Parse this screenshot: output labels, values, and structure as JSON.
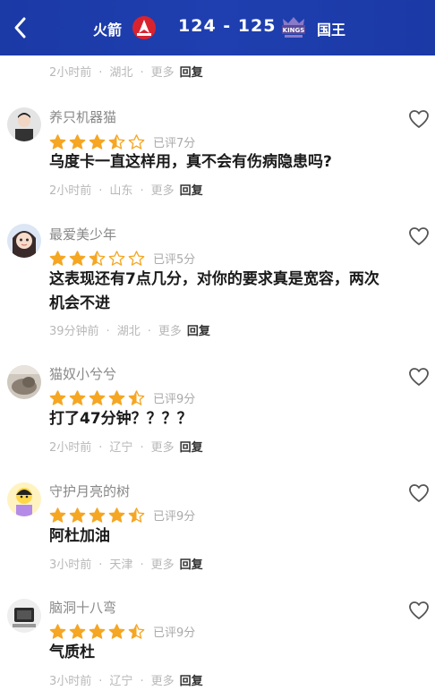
{
  "header": {
    "team_left": "火箭",
    "score": "124 - 125",
    "team_right": "国王",
    "logo_right_text": "KINGS"
  },
  "first_meta": {
    "time": "2小时前",
    "location": "湖北",
    "more": "更多",
    "reply": "回复"
  },
  "comments": [
    {
      "username": "养只机器猫",
      "rating": 3.5,
      "rated": "已评7分",
      "text": "乌度卡一直这样用，真不会有伤病隐患吗?",
      "time": "2小时前",
      "location": "山东",
      "more": "更多",
      "reply": "回复"
    },
    {
      "username": "最爱美少年",
      "rating": 2.5,
      "rated": "已评5分",
      "text": "这表现还有7点几分，对你的要求真是宽容，两次机会不进",
      "time": "39分钟前",
      "location": "湖北",
      "more": "更多",
      "reply": "回复"
    },
    {
      "username": "猫奴小兮兮",
      "rating": 4.5,
      "rated": "已评9分",
      "text": "打了47分钟？？？？",
      "time": "2小时前",
      "location": "辽宁",
      "more": "更多",
      "reply": "回复"
    },
    {
      "username": "守护月亮的树",
      "rating": 4.5,
      "rated": "已评9分",
      "text": "阿杜加油",
      "time": "3小时前",
      "location": "天津",
      "more": "更多",
      "reply": "回复"
    },
    {
      "username": "脑洞十八弯",
      "rating": 4.5,
      "rated": "已评9分",
      "text": "气质杜",
      "time": "3小时前",
      "location": "辽宁",
      "more": "更多",
      "reply": "回复"
    }
  ],
  "colors": {
    "header_bg": "#1f3aa8",
    "star": "#f5a623",
    "accent_text": "#1a1a1a"
  },
  "icons": {
    "back": "chevron-left-icon",
    "like": "heart-outline-icon",
    "star": "star-icon"
  }
}
